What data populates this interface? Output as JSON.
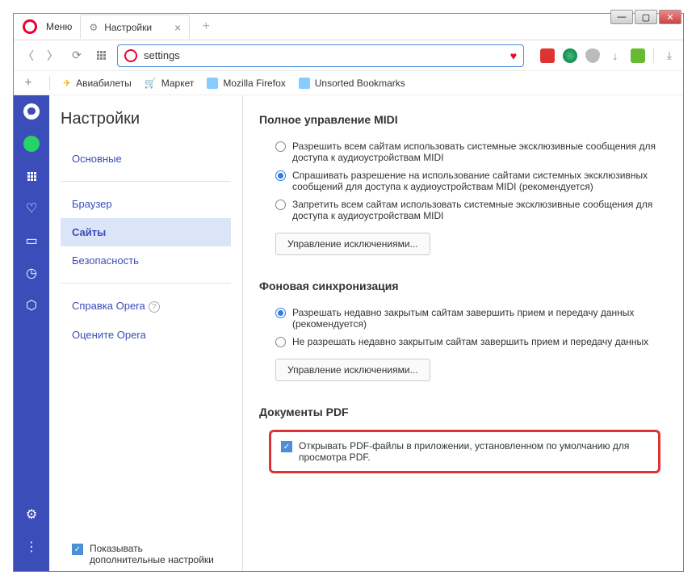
{
  "menu_label": "Меню",
  "tab": {
    "title": "Настройки"
  },
  "address": {
    "text": "settings"
  },
  "bookmarks": {
    "avia": "Авиабилеты",
    "market": "Маркет",
    "mozilla": "Mozilla Firefox",
    "unsorted": "Unsorted Bookmarks"
  },
  "settings": {
    "title": "Настройки",
    "nav": {
      "basic": "Основные",
      "browser": "Браузер",
      "sites": "Сайты",
      "security": "Безопасность",
      "help": "Справка Opera",
      "rate": "Оцените Opera"
    },
    "advanced_label": "Показывать дополнительные настройки"
  },
  "midi": {
    "title": "Полное управление MIDI",
    "opt1": "Разрешить всем сайтам использовать системные эксклюзивные сообщения для доступа к аудиоустройствам MIDI",
    "opt2": "Спрашивать разрешение на использование сайтами системных эксклюзивных сообщений для доступа к аудиоустройствам MIDI (рекомендуется)",
    "opt3": "Запретить всем сайтам использовать системные эксклюзивные сообщения для доступа к аудиоустройствам MIDI",
    "btn": "Управление исключениями..."
  },
  "sync": {
    "title": "Фоновая синхронизация",
    "opt1": "Разрешать недавно закрытым сайтам завершить прием и передачу данных (рекомендуется)",
    "opt2": "Не разрешать недавно закрытым сайтам завершить прием и передачу данных",
    "btn": "Управление исключениями..."
  },
  "pdf": {
    "title": "Документы PDF",
    "label": "Открывать PDF-файлы в приложении, установленном по умолчанию для просмотра PDF."
  }
}
